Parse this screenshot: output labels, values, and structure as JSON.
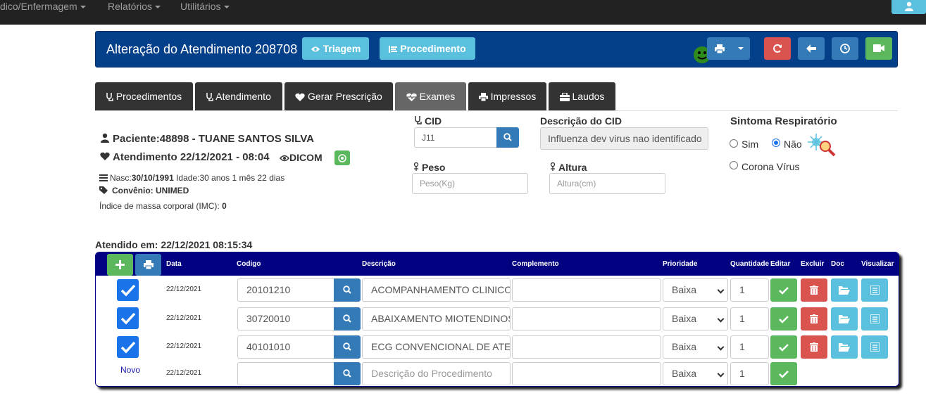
{
  "nav": {
    "items": [
      "dico/Enfermagem",
      "Relatórios",
      "Utilitários"
    ]
  },
  "header": {
    "title": "Alteração do Atendimento 208708",
    "triagem": "Triagem",
    "procedimento": "Procedimento"
  },
  "tabs": [
    "Procedimentos",
    "Atendimento",
    "Gerar Prescrição",
    "Exames",
    "Impressos",
    "Laudos"
  ],
  "patient": {
    "name": "Paciente:48898 - TUANE SANTOS SILVA",
    "atendimento": "Atendimento 22/12/2021 - 08:04",
    "dicom": "DICOM",
    "nasc_label": "Nasc:",
    "nasc_value": "30/10/1991",
    "idade": "Idade:30 anos 1 mês 22 dias",
    "convenio": "Convênio: UNIMED",
    "imc_label": "Índice de massa corporal (IMC):",
    "imc_value": "0"
  },
  "form": {
    "cid_label": "CID",
    "cid_value": "J11",
    "desc_cid_label": "Descrição do CID",
    "desc_cid_value": "Influenza dev virus nao identificado",
    "peso_label": "Peso",
    "peso_placeholder": "Peso(Kg)",
    "altura_label": "Altura",
    "altura_placeholder": "Altura(cm)",
    "sintoma_label": "Sintoma Respiratório",
    "sim": "Sim",
    "nao": "Não",
    "corona": "Corona Vírus"
  },
  "atendido_em": "Atendido em: 22/12/2021 08:15:34",
  "table": {
    "headers": [
      "Data",
      "Codigo",
      "Descrição",
      "Complemento",
      "Prioridade",
      "Quantidade",
      "Editar",
      "Excluir",
      "Doc",
      "Visualizar"
    ],
    "rows": [
      {
        "date": "22/12/2021",
        "codigo": "20101210",
        "descricao": "ACOMPANHAMENTO CLINICO",
        "prioridade": "Baixa",
        "quantidade": "1"
      },
      {
        "date": "22/12/2021",
        "codigo": "30720010",
        "descricao": "ABAIXAMENTO MIOTENDINOSO",
        "prioridade": "Baixa",
        "quantidade": "1"
      },
      {
        "date": "22/12/2021",
        "codigo": "40101010",
        "descricao": "ECG CONVENCIONAL DE ATE",
        "prioridade": "Baixa",
        "quantidade": "1"
      }
    ],
    "new_row": {
      "label": "Novo",
      "date": "22/12/2021",
      "descricao_placeholder": "Descrição do Procedimento",
      "prioridade": "Baixa",
      "quantidade": "1"
    }
  },
  "colors": {
    "nav": "#222222",
    "header": "#043f8a",
    "table_header": "#000080",
    "info": "#5bc0de",
    "primary": "#337ab7",
    "danger": "#d9534f",
    "success": "#5cb85c"
  }
}
